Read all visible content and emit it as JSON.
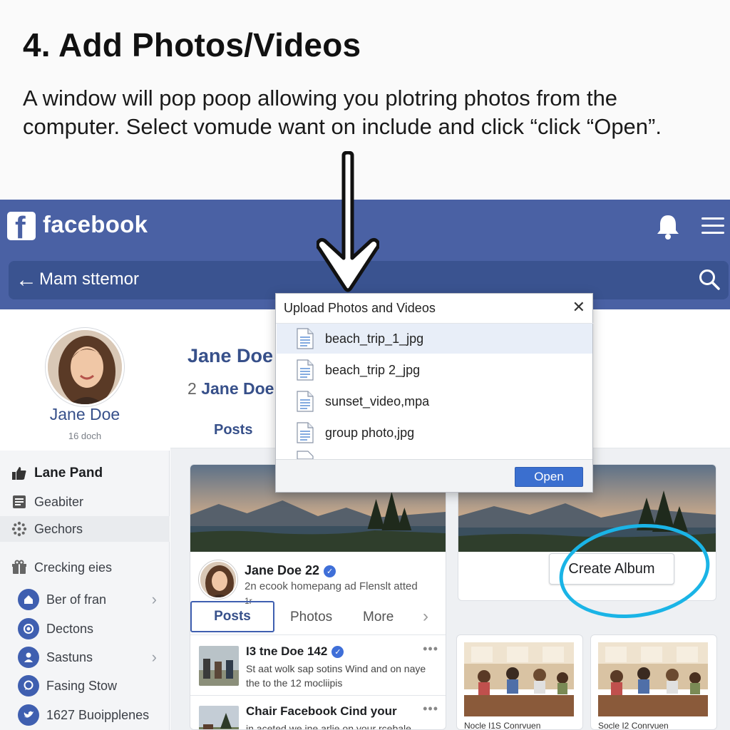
{
  "instruction": {
    "title": "4. Add Photos/Videos",
    "text": "A window will pop poop allowing you plotring photos from the computer. Select vomude want on include and click “click “Open”."
  },
  "header": {
    "logo_letter": "f",
    "brand": "facebook",
    "search_text": "Mam sttemor",
    "back_icon": "back-arrow-icon",
    "search_icon": "search-icon",
    "bell_icon": "bell-icon",
    "menu_icon": "hamburger-menu-icon",
    "color": "#4a61a4"
  },
  "sidebar": {
    "profile_name": "Jane Doe",
    "profile_sub": "16 doch",
    "items": [
      {
        "label": "Lane Pand",
        "icon": "like-icon"
      },
      {
        "label": "Geabiter",
        "icon": "list-icon"
      },
      {
        "label": "Gechors",
        "icon": "dots-circle-icon"
      },
      {
        "label": "Crecking eies",
        "icon": "gift-icon"
      }
    ],
    "links": [
      {
        "label": "Ber of fran",
        "icon": "home-icon",
        "chevron": true
      },
      {
        "label": "Dectons",
        "icon": "camera-icon",
        "chevron": false
      },
      {
        "label": "Sastuns",
        "icon": "person-icon",
        "chevron": true
      },
      {
        "label": "Fasing Stow",
        "icon": "chat-icon",
        "chevron": false
      },
      {
        "label": "1627 Buoipplenes",
        "icon": "bird-icon",
        "chevron": false
      }
    ]
  },
  "main": {
    "name": "Jane Doe",
    "sub_num": "2",
    "sub_name": "Jane Doe",
    "tab": "Posts"
  },
  "post": {
    "author": "Jane Doe 22",
    "text": "2n ecook homepang ad Flenslt atted",
    "text2": "1r",
    "tabs": {
      "posts": "Posts",
      "photos": "Photos",
      "more": "More",
      "chevron": "›"
    },
    "feed": [
      {
        "title": "I3 tne Doe 142",
        "verified": true,
        "body": "St aat wolk sap sotins Wind and on naye the to the 12 mocliipis",
        "menu": "•••"
      },
      {
        "title": "Chair Facebook Cind your",
        "verified": false,
        "body": "in aceted we ine arlie on your rcebale",
        "menu": "•••"
      }
    ]
  },
  "album": {
    "button": "Create Album",
    "highlight_color": "#1ab4e6",
    "photos": [
      {
        "caption": "Nocle I1S Conrvuen"
      },
      {
        "caption": "Socle I2 Conrvuen"
      }
    ]
  },
  "dialog": {
    "title": "Upload Photos and Videos",
    "close": "✕",
    "files": [
      {
        "name": "beach_trip_1_jpg",
        "selected": true
      },
      {
        "name": "beach_trip 2_jpg",
        "selected": false
      },
      {
        "name": "sunset_video,mpa",
        "selected": false
      },
      {
        "name": "group photo,jpg",
        "selected": false
      }
    ],
    "open_label": "Open",
    "accent": "#3b6fcf"
  }
}
